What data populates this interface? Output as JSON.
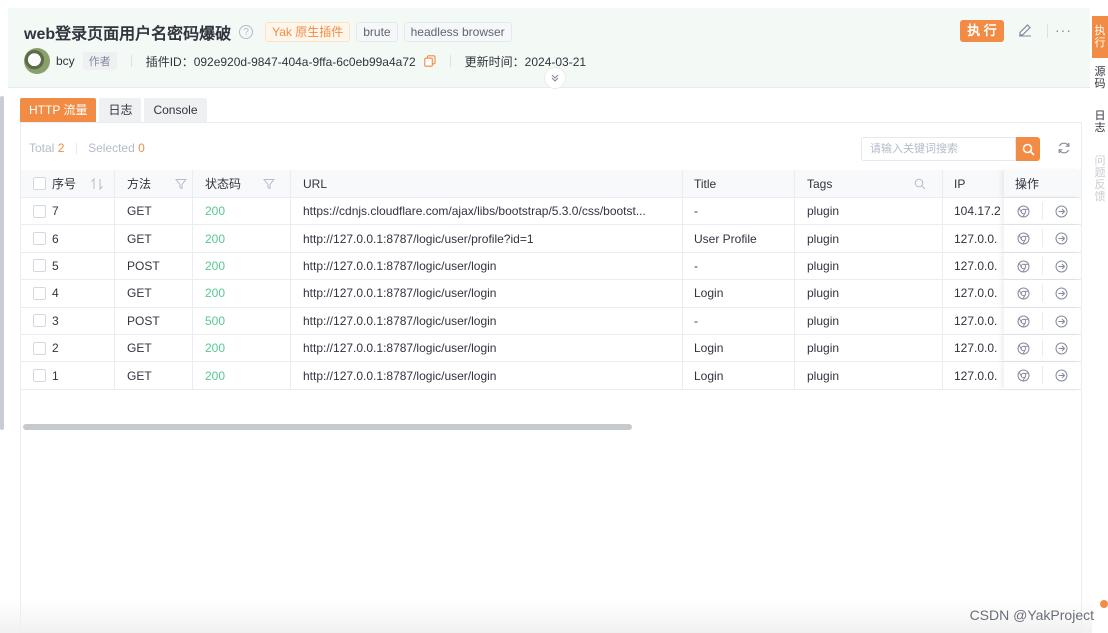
{
  "header": {
    "title": "web登录页面用户名密码爆破",
    "help_icon": "question-circle-icon",
    "tags": [
      "Yak 原生插件",
      "brute",
      "headless browser"
    ],
    "exec_label": "执 行",
    "author": "bcy",
    "author_tag": "作者",
    "plugin_id": "插件ID：092e920d-9847-404a-9ffa-6c0eb99a4a72",
    "update_time": "更新时间：2024-03-21",
    "colors": {
      "accent": "#f28b44",
      "header_bg": "#f3f9f4"
    }
  },
  "tabs": [
    "HTTP 流量",
    "日志",
    "Console"
  ],
  "toolbar": {
    "total_label": "Total",
    "total": "2",
    "selected_label": "Selected",
    "selected": "0",
    "search_placeholder": "请输入关键词搜索"
  },
  "table": {
    "columns": [
      "序号",
      "方法",
      "状态码",
      "URL",
      "Title",
      "Tags",
      "IP",
      "操作"
    ],
    "rows": [
      {
        "id": "7",
        "method": "GET",
        "status": "200",
        "url": "https://cdnjs.cloudflare.com/ajax/libs/bootstrap/5.3.0/css/bootst...",
        "title": "-",
        "tags": "plugin",
        "ip": "104.17.2"
      },
      {
        "id": "6",
        "method": "GET",
        "status": "200",
        "url": "http://127.0.0.1:8787/logic/user/profile?id=1",
        "title": "User Profile",
        "tags": "plugin",
        "ip": "127.0.0."
      },
      {
        "id": "5",
        "method": "POST",
        "status": "200",
        "url": "http://127.0.0.1:8787/logic/user/login",
        "title": "-",
        "tags": "plugin",
        "ip": "127.0.0."
      },
      {
        "id": "4",
        "method": "GET",
        "status": "200",
        "url": "http://127.0.0.1:8787/logic/user/login",
        "title": "Login",
        "tags": "plugin",
        "ip": "127.0.0."
      },
      {
        "id": "3",
        "method": "POST",
        "status": "500",
        "url": "http://127.0.0.1:8787/logic/user/login",
        "title": "-",
        "tags": "plugin",
        "ip": "127.0.0."
      },
      {
        "id": "2",
        "method": "GET",
        "status": "200",
        "url": "http://127.0.0.1:8787/logic/user/login",
        "title": "Login",
        "tags": "plugin",
        "ip": "127.0.0."
      },
      {
        "id": "1",
        "method": "GET",
        "status": "200",
        "url": "http://127.0.0.1:8787/logic/user/login",
        "title": "Login",
        "tags": "plugin",
        "ip": "127.0.0."
      }
    ]
  },
  "right_sidebar": [
    "执行",
    "源码",
    "日志",
    "问题反馈"
  ],
  "watermark": "CSDN @YakProject"
}
